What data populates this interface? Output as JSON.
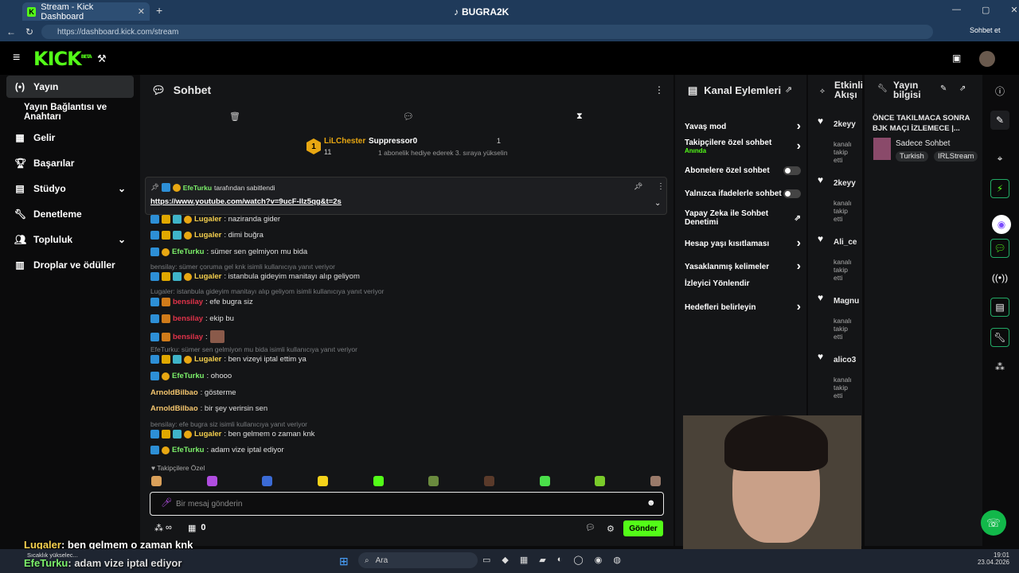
{
  "browser": {
    "tab_title": "Stream - Kick Dashboard",
    "center_title": "BUGRA2K",
    "url": "https://dashboard.kick.com/stream",
    "sidebar_right": "Sohbet et"
  },
  "header": {
    "logo": "KICK",
    "logo_sup": "BETA"
  },
  "sidebar": {
    "items": [
      {
        "label": "Yayın",
        "icon": "broadcast-icon"
      },
      {
        "label": "Yayın Bağlantısı ve Anahtarı",
        "icon": ""
      },
      {
        "label": "Gelir",
        "icon": "revenue-icon"
      },
      {
        "label": "Başarılar",
        "icon": "trophy-icon"
      },
      {
        "label": "Stüdyo",
        "icon": "studio-icon"
      },
      {
        "label": "Denetleme",
        "icon": "wrench-icon"
      },
      {
        "label": "Topluluk",
        "icon": "users-icon"
      },
      {
        "label": "Droplar ve ödüller",
        "icon": "gift-icon"
      }
    ]
  },
  "chat": {
    "title": "Sohbet",
    "gift_user": "LiLChester",
    "gift_count": "11",
    "gift_target": "Suppressor0",
    "gift_target_count": "1",
    "gift_text": "1 abonelik hediye ederek 3. sıraya yükselin",
    "pinned_by": "EfeTurku",
    "pinned_label": "tarafından sabitlendi",
    "pinned_link": "https://www.youtube.com/watch?v=9ucF-Ilz5qg&t=2s",
    "messages": [
      {
        "user": "Lugaler",
        "text": ": nazirandа gider",
        "color": "#f5d04e"
      },
      {
        "user": "Lugaler",
        "text": ": dimi buğra",
        "color": "#f5d04e"
      },
      {
        "user": "EfeTurku",
        "text": ": sümer sen gelmiyon mu bida",
        "color": "#7cf06a"
      },
      {
        "reply": "bensilay: sümer çoruma gel knk isimli kullanıcıya yanıt veriyor"
      },
      {
        "user": "Lugaler",
        "text": ": istanbula gideyim manitayı alıp geliyom",
        "color": "#f5d04e"
      },
      {
        "reply": "Lugaler: istanbula gideyim manitayı alıp geliyom isimli kullanıcıya yanıt veriyor"
      },
      {
        "user": "bensilay",
        "text": ": efe bugra siz",
        "color": "#e0334a"
      },
      {
        "user": "bensilay",
        "text": ": ekip bu",
        "color": "#e0334a"
      },
      {
        "user": "bensilay",
        "text": ":",
        "color": "#e0334a"
      },
      {
        "reply": "EfeTurku: sümer sen gelmiyon mu bida isimli kullanıcıya yanıt veriyor"
      },
      {
        "user": "Lugaler",
        "text": ": ben vizeyi iptal ettim ya",
        "color": "#f5d04e"
      },
      {
        "user": "EfeTurku",
        "text": ": ohooo",
        "color": "#7cf06a"
      },
      {
        "user": "ArnoldBilbao",
        "text": ": gösterme",
        "color": "#f5c66e"
      },
      {
        "user": "ArnoldBilbao",
        "text": ": bir şey verirsin sen",
        "color": "#f5c66e"
      },
      {
        "reply": "bensilay: efe bugra siz isimli kullanıcıya yanıt veriyor"
      },
      {
        "user": "Lugaler",
        "text": ": ben gelmem o zaman knk",
        "color": "#f5d04e"
      },
      {
        "user": "EfeTurku",
        "text": ": adam vize iptal ediyor",
        "color": "#7cf06a"
      }
    ],
    "followers_only": "Takipçilere Özel",
    "input_placeholder": "Bir mesaj gönderin",
    "infinite": "∞",
    "box_count": "0",
    "send": "Gönder"
  },
  "actions": {
    "title": "Kanal Eylemleri",
    "items": [
      {
        "label": "Yavaş mod",
        "kind": "arrow"
      },
      {
        "label": "Takipçilere özel sohbet",
        "sub": "Anında",
        "kind": "arrow"
      },
      {
        "label": "Abonelere özel sohbet",
        "kind": "toggle"
      },
      {
        "label": "Yalnızca ifadelerle sohbet",
        "kind": "toggle"
      },
      {
        "label": "Yapay Zeka ile Sohbet Denetimi",
        "kind": "external"
      },
      {
        "label": "Hesap yaşı kısıtlaması",
        "kind": "arrow"
      },
      {
        "label": "Yasaklanmış kelimeler",
        "kind": "arrow"
      },
      {
        "label": "İzleyici Yönlendir",
        "kind": "none"
      },
      {
        "label": "Hedefleri belirleyin",
        "kind": "arrow"
      }
    ]
  },
  "activity": {
    "title": "Etkinlik Akışı",
    "items": [
      {
        "user": "2keyy",
        "text": "kanalı takip etti"
      },
      {
        "user": "2keyy",
        "text": "kanalı takip etti"
      },
      {
        "user": "Ali_ce",
        "text": "kanalı takip etti"
      },
      {
        "user": "Magnu",
        "text": "kanalı takip etti"
      },
      {
        "user": "alico3",
        "text": "kanalı takip etti"
      }
    ]
  },
  "info": {
    "title": "Yayın bilgisi",
    "stream_title": "ÖNCE TAKILMACA SONRA BJK MAÇI İZLEMECE |...",
    "category": "Sadece Sohbet",
    "tags": [
      "Turkish",
      "IRLStream"
    ]
  },
  "overlay": {
    "line1_user": "Lugaler",
    "line1_text": ": ben gelmem o zaman knk",
    "line2_user": "EfeTurku",
    "line2_text": ": adam vize iptal ediyor"
  },
  "taskbar": {
    "weather": "Sıcaklık yükselec...",
    "search": "Ara",
    "time": "19:01",
    "date": "23.04.2026"
  }
}
